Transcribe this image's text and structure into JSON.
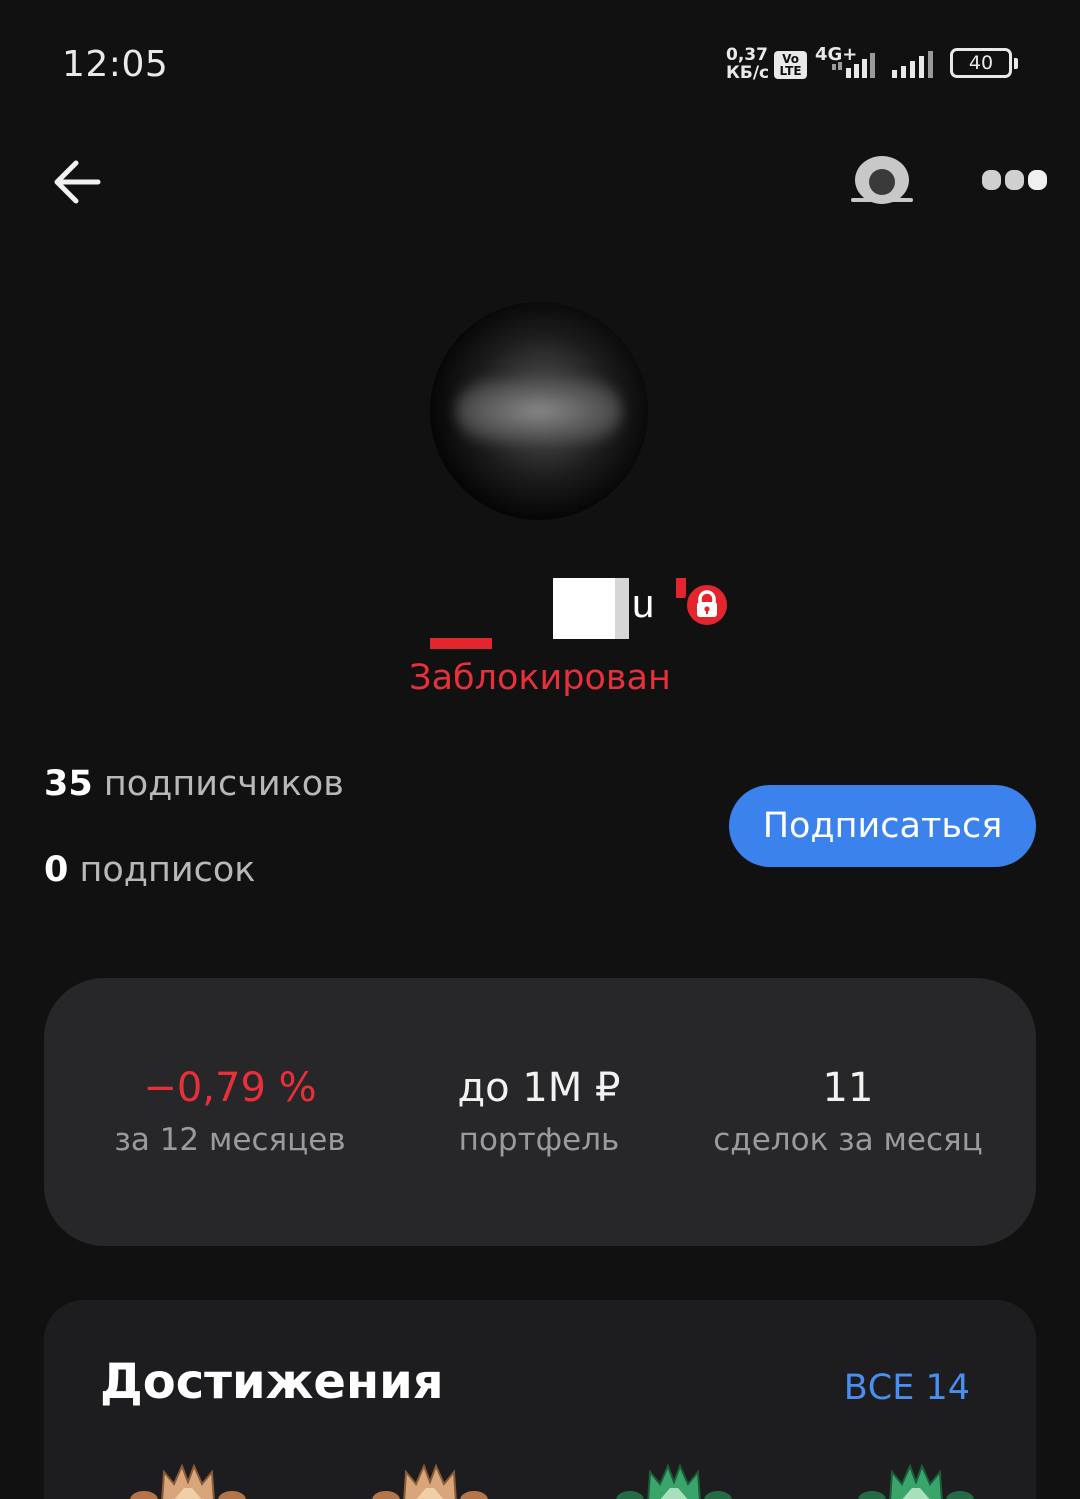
{
  "status_bar": {
    "time": "12:05",
    "net_speed_value": "0,37",
    "net_speed_unit": "КБ/с",
    "volte_top": "Vo",
    "volte_bottom": "LTE",
    "network_type": "4G+",
    "battery_level": "40"
  },
  "header": {
    "back_icon": "arrow-left-icon",
    "camera_icon": "webcam-icon",
    "more_icon": "more-dots-icon"
  },
  "profile": {
    "name_visible_part": "u",
    "lock_icon": "lock-icon",
    "status_label": "Заблокирован",
    "status_color": "#e8303a"
  },
  "stats": {
    "followers_count": "35",
    "followers_label": "подписчиков",
    "following_count": "0",
    "following_label": "подписок",
    "subscribe_label": "Подписаться",
    "accent_color": "#3c82ec"
  },
  "metrics": [
    {
      "value": "−0,79 %",
      "label": "за 12 месяцев"
    },
    {
      "value": "до 1М ₽",
      "label": "портфель"
    },
    {
      "value": "11",
      "label": "сделок за месяц"
    }
  ],
  "achievements": {
    "title": "Достижения",
    "all_label": "ВСЕ 14",
    "badges": [
      {
        "icon": "crown-badge-icon",
        "color": "#c9895a"
      },
      {
        "icon": "crown-badge-icon",
        "color": "#c9895a"
      },
      {
        "icon": "crown-badge-icon",
        "color": "#2e8b57"
      },
      {
        "icon": "crown-badge-icon",
        "color": "#2e8b57"
      }
    ]
  }
}
